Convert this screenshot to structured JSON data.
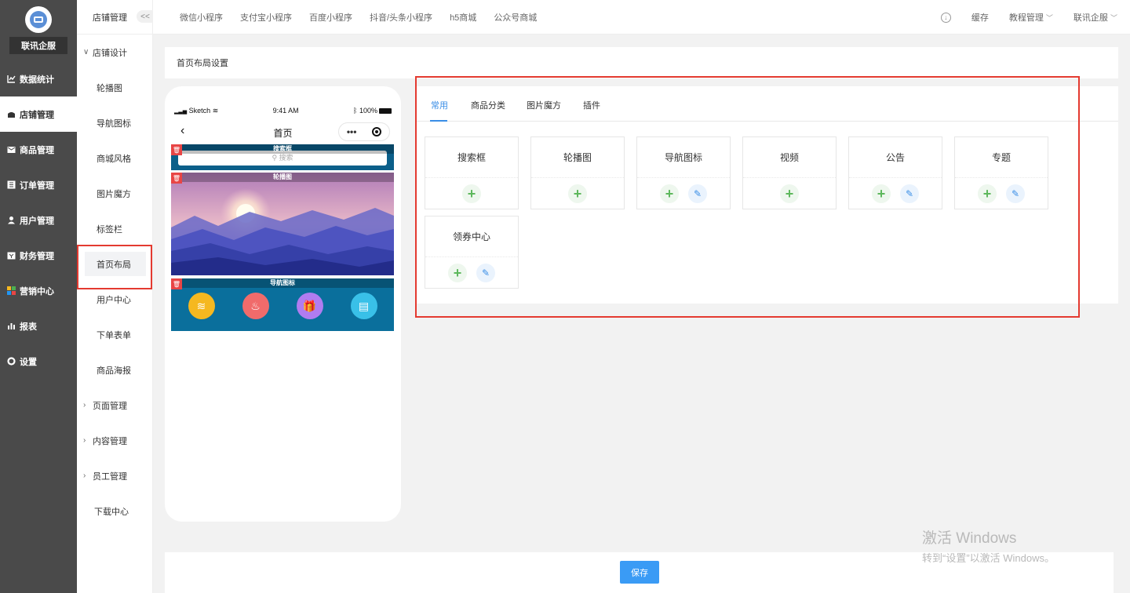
{
  "sidebar": {
    "brand": "联讯企服",
    "items": [
      {
        "label": "数据统计",
        "icon": "chart-line-icon"
      },
      {
        "label": "店铺管理",
        "icon": "shop-icon",
        "active": true
      },
      {
        "label": "商品管理",
        "icon": "mail-icon"
      },
      {
        "label": "订单管理",
        "icon": "list-icon"
      },
      {
        "label": "用户管理",
        "icon": "user-icon"
      },
      {
        "label": "财务管理",
        "icon": "wallet-icon"
      },
      {
        "label": "营销中心",
        "icon": "puzzle-icon"
      },
      {
        "label": "报表",
        "icon": "bar-chart-icon"
      },
      {
        "label": "设置",
        "icon": "gear-icon"
      }
    ]
  },
  "subsidebar": {
    "header": "店铺管理",
    "collapse": "<<",
    "group_store_design": "店铺设计",
    "leaves": [
      "轮播图",
      "导航图标",
      "商城风格",
      "图片魔方",
      "标签栏",
      "首页布局",
      "用户中心",
      "下单表单",
      "商品海报"
    ],
    "groups": [
      "页面管理",
      "内容管理",
      "员工管理"
    ],
    "download": "下载中心"
  },
  "topbar": {
    "tabs": [
      "微信小程序",
      "支付宝小程序",
      "百度小程序",
      "抖音/头条小程序",
      "h5商城",
      "公众号商城"
    ],
    "cache": "缓存",
    "tutorial": "教程管理",
    "account": "联讯企服"
  },
  "breadcrumb": "首页布局设置",
  "phone": {
    "carrier": "Sketch",
    "time": "9:41 AM",
    "battery": "100%",
    "title": "首页",
    "menu_dots": "•••",
    "search_label": "搜索框",
    "search_placeholder": "搜索",
    "carousel_label": "轮播图",
    "nav_label": "导航图标"
  },
  "panel": {
    "tabs": [
      "常用",
      "商品分类",
      "图片魔方",
      "插件"
    ],
    "components": [
      {
        "name": "搜索框",
        "editable": false
      },
      {
        "name": "轮播图",
        "editable": false
      },
      {
        "name": "导航图标",
        "editable": true
      },
      {
        "name": "视频",
        "editable": false
      },
      {
        "name": "公告",
        "editable": true
      },
      {
        "name": "专题",
        "editable": true
      },
      {
        "name": "领券中心",
        "editable": true
      }
    ]
  },
  "save_label": "保存",
  "watermark": {
    "line1": "激活 Windows",
    "line2": "转到“设置”以激活 Windows。"
  },
  "colors": {
    "accent": "#3a8ee6",
    "highlight_border": "#e43a30",
    "sidebar_bg": "#4a4a4a",
    "nav_icons": [
      "#f5b820",
      "#f06b6b",
      "#b07cf0",
      "#39c0e8"
    ]
  }
}
